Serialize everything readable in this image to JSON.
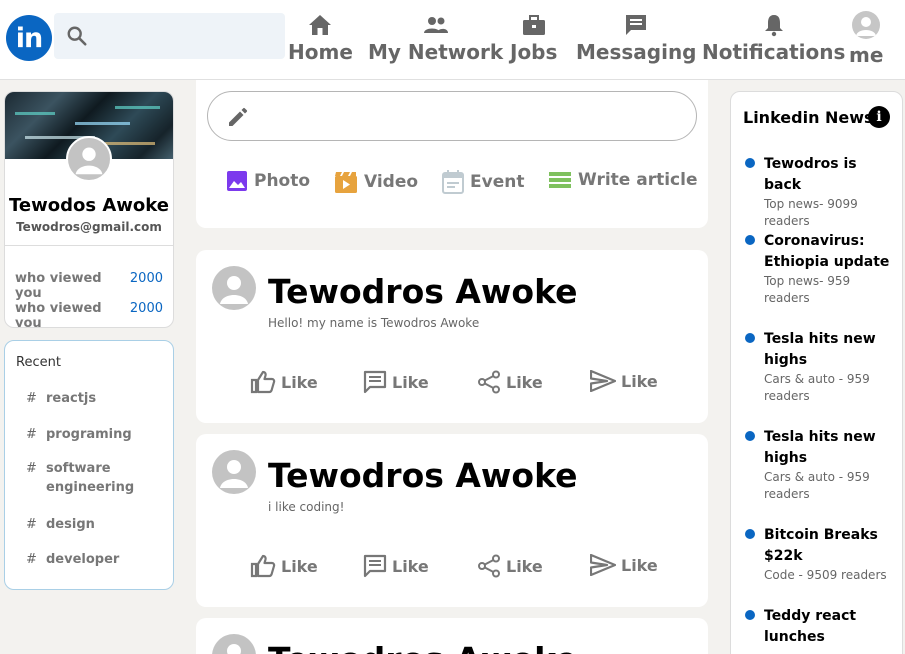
{
  "header": {
    "logo_text": "in",
    "search_placeholder": "",
    "nav": [
      {
        "label": "Home",
        "icon": "home-icon"
      },
      {
        "label": "My Network",
        "icon": "people-icon"
      },
      {
        "label": "Jobs",
        "icon": "briefcase-icon"
      },
      {
        "label": "Messaging",
        "icon": "message-icon"
      },
      {
        "label": "Notifications",
        "icon": "bell-icon"
      },
      {
        "label": "me",
        "icon": "avatar-icon"
      }
    ]
  },
  "profile": {
    "name": "Tewodos Awoke",
    "email": "Tewodros@gmail.com",
    "stats": [
      {
        "label": "who viewed you",
        "value": "2000"
      },
      {
        "label": "who viewed you",
        "value": "2000"
      }
    ]
  },
  "recent": {
    "title": "Recent",
    "tags": [
      {
        "hash": "#",
        "label": "reactjs"
      },
      {
        "hash": "#",
        "label": "programing"
      },
      {
        "hash": "#",
        "label": "software engineering"
      },
      {
        "hash": "#",
        "label": "design"
      },
      {
        "hash": "#",
        "label": "developer"
      }
    ]
  },
  "composer": {
    "actions": [
      {
        "label": "Photo",
        "icon": "photo-icon",
        "color": "#7c3aed"
      },
      {
        "label": "Video",
        "icon": "video-icon",
        "color": "#e7a33e"
      },
      {
        "label": "Event",
        "icon": "event-icon",
        "color": "#c0cbd1"
      },
      {
        "label": "Write article",
        "icon": "article-icon",
        "color": "#7fc15e"
      }
    ]
  },
  "posts": [
    {
      "name": "Tewodros Awoke",
      "text": "Hello! my name is Tewodros Awoke",
      "actions": [
        "Like",
        "Like",
        "Like",
        "Like"
      ]
    },
    {
      "name": "Tewodros Awoke",
      "text": "i like coding!",
      "actions": [
        "Like",
        "Like",
        "Like",
        "Like"
      ]
    },
    {
      "name": "Tewodros Awoke",
      "text": "",
      "actions": []
    }
  ],
  "news": {
    "title": "Linkedin News",
    "info_glyph": "i",
    "items": [
      {
        "headline": "Tewodros is back",
        "sub": "Top news- 9099 readers"
      },
      {
        "headline": "Coronavirus: Ethiopia update",
        "sub": "Top news- 959 readers"
      },
      {
        "headline": "Tesla hits new highs",
        "sub": "Cars & auto - 959 readers"
      },
      {
        "headline": "Tesla hits new highs",
        "sub": "Cars & auto - 959 readers"
      },
      {
        "headline": "Bitcoin Breaks $22k",
        "sub": "Code - 9509 readers"
      },
      {
        "headline": "Teddy react lunches",
        "sub": ""
      }
    ]
  },
  "colors": {
    "brand": "#0a66c2",
    "background": "#f3f2ef"
  }
}
